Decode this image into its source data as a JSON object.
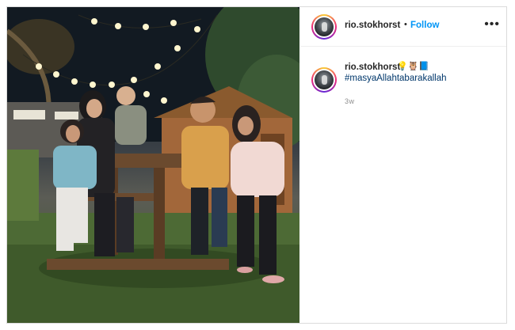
{
  "post": {
    "username": "rio.stokhorst",
    "separator": "•",
    "follow_label": "Follow",
    "more_label": "•••",
    "caption": {
      "username": "rio.stokhorst",
      "emojis": "💡🦉📘",
      "hashtag": "#masyaAllahtabarakallah",
      "timestamp": "3w"
    },
    "photo_icon": "family-photo",
    "avatar_icon": "profile-avatar"
  }
}
